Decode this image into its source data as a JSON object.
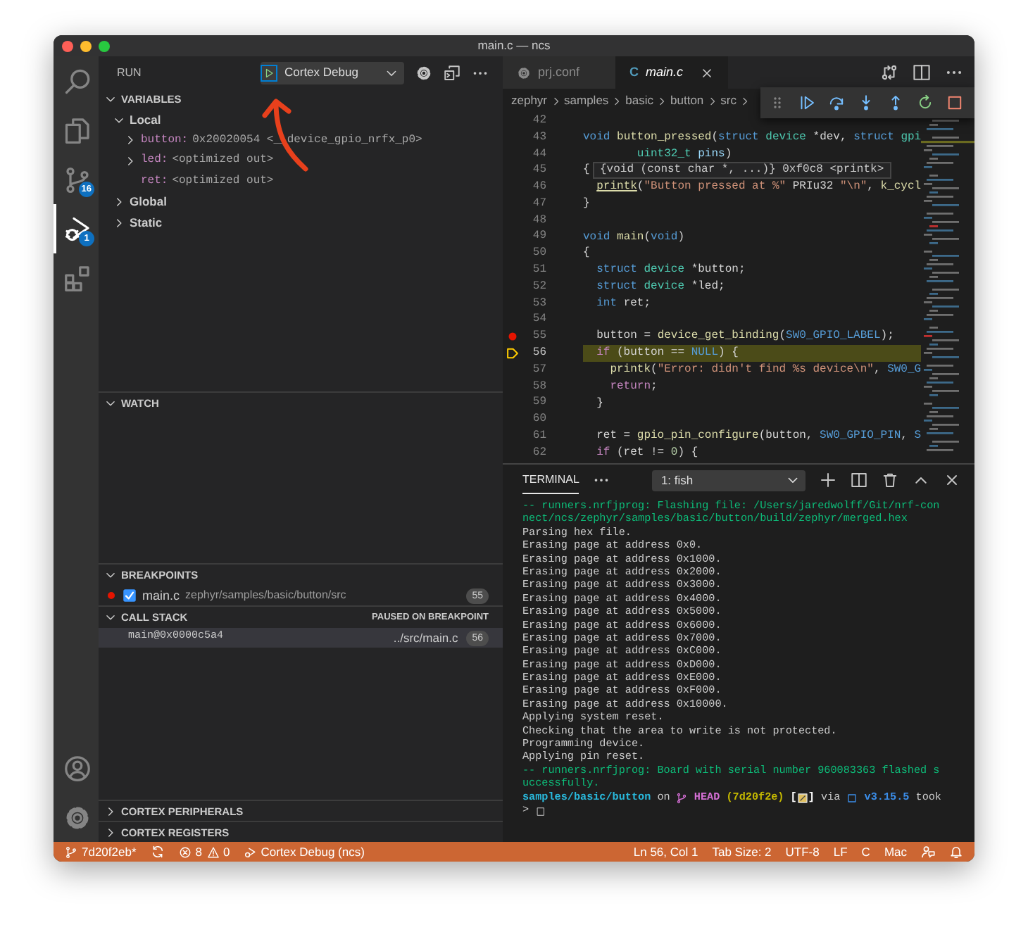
{
  "window": {
    "title": "main.c — ncs"
  },
  "activity_bar": {
    "items": [
      {
        "kind": "search",
        "selected": false
      },
      {
        "kind": "explorer",
        "selected": false
      },
      {
        "kind": "source-control",
        "selected": false,
        "badge": "16"
      },
      {
        "kind": "run",
        "selected": true,
        "badge": "1"
      },
      {
        "kind": "extensions",
        "selected": false
      }
    ],
    "bottom": [
      {
        "kind": "account"
      },
      {
        "kind": "settings"
      }
    ]
  },
  "run_panel": {
    "title": "RUN",
    "config": "Cortex Debug"
  },
  "variables": {
    "title": "VARIABLES",
    "expanded": true,
    "scopes": [
      {
        "name": "Local",
        "expanded": true,
        "variables": [
          {
            "name": "button:",
            "value": "0x20020054 <__device_gpio_nrfx_p0>",
            "expandable": true
          },
          {
            "name": "led:",
            "value": "<optimized out>",
            "expandable": true
          },
          {
            "name": "ret:",
            "value": "<optimized out>",
            "expandable": false
          }
        ]
      },
      {
        "name": "Global",
        "expanded": false
      },
      {
        "name": "Static",
        "expanded": false
      }
    ]
  },
  "watch": {
    "title": "WATCH",
    "expanded": true
  },
  "breakpoints": {
    "title": "BREAKPOINTS",
    "expanded": true,
    "items": [
      {
        "file": "main.c",
        "path": "zephyr/samples/basic/button/src",
        "line": "55",
        "checked": true
      }
    ]
  },
  "call_stack": {
    "title": "CALL STACK",
    "expanded": true,
    "status": "PAUSED ON BREAKPOINT",
    "frames": [
      {
        "name": "main@0x0000c5a4",
        "file": "../src/main.c",
        "line": "56",
        "selected": true
      }
    ]
  },
  "collapsed_sections": [
    {
      "title": "CORTEX PERIPHERALS",
      "expanded": false
    },
    {
      "title": "CORTEX REGISTERS",
      "expanded": false
    }
  ],
  "editor": {
    "tabs": [
      {
        "label": "prj.conf",
        "kind": "config",
        "selected": false,
        "preview": false
      },
      {
        "label": "main.c",
        "kind": "c",
        "icon_text": "C",
        "selected": true,
        "preview": true
      }
    ],
    "breadcrumb": [
      "zephyr",
      "samples",
      "basic",
      "button",
      "src"
    ],
    "hover": "{void (const char *, ...)} 0xf0c8 <printk>",
    "lines": [
      {
        "number": "42",
        "breakpoint": false,
        "paused": false
      },
      {
        "number": "43",
        "breakpoint": false,
        "paused": false,
        "tokens": [
          {
            "kind": "kw",
            "text": "void "
          },
          {
            "kind": "fn",
            "text": "button_pressed"
          },
          {
            "kind": "plain",
            "text": "("
          },
          {
            "kind": "kw",
            "text": "struct "
          },
          {
            "kind": "type",
            "text": "device"
          },
          {
            "kind": "plain",
            "text": " *dev, "
          },
          {
            "kind": "kw",
            "text": "struct "
          },
          {
            "kind": "type",
            "text": "gpi"
          }
        ]
      },
      {
        "number": "44",
        "breakpoint": false,
        "paused": false,
        "tokens": [
          {
            "kind": "type",
            "text": "        uint32_t "
          },
          {
            "kind": "var",
            "text": "pins"
          },
          {
            "kind": "plain",
            "text": ")"
          }
        ]
      },
      {
        "number": "45",
        "breakpoint": false,
        "paused": false,
        "tokens": [
          {
            "kind": "plain",
            "text": "{"
          }
        ]
      },
      {
        "number": "46",
        "breakpoint": false,
        "paused": false,
        "tokens": [
          {
            "kind": "link",
            "text": "  printk"
          },
          {
            "kind": "plain",
            "text": "("
          },
          {
            "kind": "str",
            "text": "\"Button pressed at %\""
          },
          {
            "kind": "plain",
            "text": " PRIu32 "
          },
          {
            "kind": "str",
            "text": "\"\\n\""
          },
          {
            "kind": "plain",
            "text": ", "
          },
          {
            "kind": "fn",
            "text": "k_cycl"
          }
        ]
      },
      {
        "number": "47",
        "breakpoint": false,
        "paused": false,
        "tokens": [
          {
            "kind": "plain",
            "text": "}"
          }
        ]
      },
      {
        "number": "48",
        "breakpoint": false,
        "paused": false
      },
      {
        "number": "49",
        "breakpoint": false,
        "paused": false,
        "tokens": [
          {
            "kind": "kw",
            "text": "void "
          },
          {
            "kind": "fn",
            "text": "main"
          },
          {
            "kind": "plain",
            "text": "("
          },
          {
            "kind": "kw",
            "text": "void"
          },
          {
            "kind": "plain",
            "text": ")"
          }
        ]
      },
      {
        "number": "50",
        "breakpoint": false,
        "paused": false,
        "tokens": [
          {
            "kind": "plain",
            "text": "{"
          }
        ]
      },
      {
        "number": "51",
        "breakpoint": false,
        "paused": false,
        "tokens": [
          {
            "kind": "kw",
            "text": "  struct "
          },
          {
            "kind": "type",
            "text": "device"
          },
          {
            "kind": "plain",
            "text": " *button;"
          }
        ]
      },
      {
        "number": "52",
        "breakpoint": false,
        "paused": false,
        "tokens": [
          {
            "kind": "kw",
            "text": "  struct "
          },
          {
            "kind": "type",
            "text": "device"
          },
          {
            "kind": "plain",
            "text": " *led;"
          }
        ]
      },
      {
        "number": "53",
        "breakpoint": false,
        "paused": false,
        "tokens": [
          {
            "kind": "kw",
            "text": "  int"
          },
          {
            "kind": "plain",
            "text": " ret;"
          }
        ]
      },
      {
        "number": "54",
        "breakpoint": false,
        "paused": false
      },
      {
        "number": "55",
        "breakpoint": true,
        "paused": false,
        "tokens": [
          {
            "kind": "plain",
            "text": "  button = "
          },
          {
            "kind": "fn",
            "text": "device_get_binding"
          },
          {
            "kind": "plain",
            "text": "("
          },
          {
            "kind": "macro",
            "text": "SW0_GPIO_LABEL"
          },
          {
            "kind": "plain",
            "text": ");"
          }
        ]
      },
      {
        "number": "56",
        "breakpoint": false,
        "paused": true,
        "tokens": [
          {
            "kind": "ctrl",
            "text": "  if"
          },
          {
            "kind": "plain",
            "text": " (button == "
          },
          {
            "kind": "macro",
            "text": "NULL"
          },
          {
            "kind": "plain",
            "text": ") {"
          }
        ]
      },
      {
        "number": "57",
        "breakpoint": false,
        "paused": false,
        "tokens": [
          {
            "kind": "fn",
            "text": "    printk"
          },
          {
            "kind": "plain",
            "text": "("
          },
          {
            "kind": "str",
            "text": "\"Error: didn't find %s device\\n\""
          },
          {
            "kind": "plain",
            "text": ", "
          },
          {
            "kind": "macro",
            "text": "SW0_G"
          }
        ]
      },
      {
        "number": "58",
        "breakpoint": false,
        "paused": false,
        "tokens": [
          {
            "kind": "ctrl",
            "text": "    return"
          },
          {
            "kind": "plain",
            "text": ";"
          }
        ]
      },
      {
        "number": "59",
        "breakpoint": false,
        "paused": false,
        "tokens": [
          {
            "kind": "plain",
            "text": "  }"
          }
        ]
      },
      {
        "number": "60",
        "breakpoint": false,
        "paused": false
      },
      {
        "number": "61",
        "breakpoint": false,
        "paused": false,
        "tokens": [
          {
            "kind": "plain",
            "text": "  ret = "
          },
          {
            "kind": "fn",
            "text": "gpio_pin_configure"
          },
          {
            "kind": "plain",
            "text": "(button, "
          },
          {
            "kind": "macro",
            "text": "SW0_GPIO_PIN"
          },
          {
            "kind": "plain",
            "text": ", "
          },
          {
            "kind": "macro",
            "text": "S"
          }
        ]
      },
      {
        "number": "62",
        "breakpoint": false,
        "paused": false,
        "tokens": [
          {
            "kind": "ctrl",
            "text": "  if"
          },
          {
            "kind": "plain",
            "text": " (ret != "
          },
          {
            "kind": "num",
            "text": "0"
          },
          {
            "kind": "plain",
            "text": ") {"
          }
        ]
      }
    ]
  },
  "terminal": {
    "tabs": [
      {
        "label": "TERMINAL",
        "selected": true
      }
    ],
    "instance": "1: fish",
    "lines": [
      {
        "kind": "info",
        "text": "-- runners.nrfjprog: Flashing file: /Users/jaredwolff/Git/nrf-con"
      },
      {
        "kind": "info",
        "text": "nect/ncs/zephyr/samples/basic/button/build/zephyr/merged.hex"
      },
      {
        "kind": "output",
        "text": "Parsing hex file."
      },
      {
        "kind": "output",
        "text": "Erasing page at address 0x0."
      },
      {
        "kind": "output",
        "text": "Erasing page at address 0x1000."
      },
      {
        "kind": "output",
        "text": "Erasing page at address 0x2000."
      },
      {
        "kind": "output",
        "text": "Erasing page at address 0x3000."
      },
      {
        "kind": "output",
        "text": "Erasing page at address 0x4000."
      },
      {
        "kind": "output",
        "text": "Erasing page at address 0x5000."
      },
      {
        "kind": "output",
        "text": "Erasing page at address 0x6000."
      },
      {
        "kind": "output",
        "text": "Erasing page at address 0x7000."
      },
      {
        "kind": "output",
        "text": "Erasing page at address 0xC000."
      },
      {
        "kind": "output",
        "text": "Erasing page at address 0xD000."
      },
      {
        "kind": "output",
        "text": "Erasing page at address 0xE000."
      },
      {
        "kind": "output",
        "text": "Erasing page at address 0xF000."
      },
      {
        "kind": "output",
        "text": "Erasing page at address 0x10000."
      },
      {
        "kind": "output",
        "text": "Applying system reset."
      },
      {
        "kind": "output",
        "text": "Checking that the area to write is not protected."
      },
      {
        "kind": "output",
        "text": "Programming device."
      },
      {
        "kind": "output",
        "text": "Applying pin reset."
      },
      {
        "kind": "info",
        "text": "-- runners.nrfjprog: Board with serial number 960083363 flashed s"
      },
      {
        "kind": "info",
        "text": "uccessfully."
      }
    ],
    "prompt": [
      {
        "kind": "path",
        "text": "samples/basic/button"
      },
      {
        "kind": "plain",
        "text": " on "
      },
      {
        "kind": "branch-icon"
      },
      {
        "kind": "branch",
        "text": " HEAD"
      },
      {
        "kind": "hash",
        "text": " (7d20f2e)"
      },
      {
        "kind": "bracket",
        "text": " ["
      },
      {
        "kind": "note-icon"
      },
      {
        "kind": "bracket",
        "text": "]"
      },
      {
        "kind": "plain",
        "text": " via "
      },
      {
        "kind": "version-icon"
      },
      {
        "kind": "version",
        "text": " v3.15.5"
      },
      {
        "kind": "plain",
        "text": " took"
      }
    ],
    "input_symbol": ">"
  },
  "status_bar": {
    "left": [
      {
        "kind": "branch",
        "text": "7d20f2eb*"
      },
      {
        "kind": "sync"
      },
      {
        "kind": "problems",
        "errors": "8",
        "warnings": "0"
      },
      {
        "kind": "debug",
        "text": "Cortex Debug (ncs)"
      }
    ],
    "right": [
      "Ln 56, Col 1",
      "Tab Size: 2",
      "UTF-8",
      "LF",
      "C",
      "Mac"
    ]
  }
}
